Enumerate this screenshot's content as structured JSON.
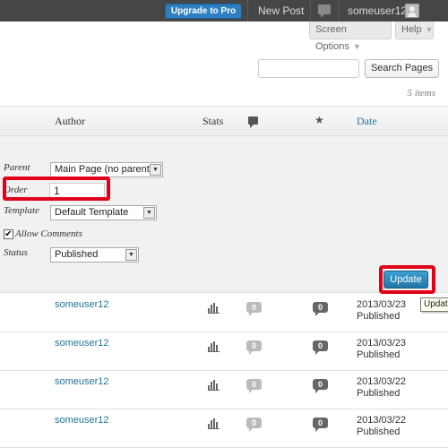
{
  "adminbar": {
    "upgrade_label": "Upgrade to Pro",
    "new_post_label": "New Post",
    "username": "someuser12"
  },
  "screen_meta": {
    "screen_options_label": "Screen Options",
    "help_label": "Help"
  },
  "search": {
    "value": "",
    "button_label": "Search Pages"
  },
  "items_count": "5 items",
  "table": {
    "columns": {
      "author": "Author",
      "stats": "Stats",
      "date": "Date"
    }
  },
  "quick_edit": {
    "parent_label": "Parent",
    "parent_value": "Main Page (no parent)",
    "order_label": "Order",
    "order_value": "1",
    "template_label": "Template",
    "template_value": "Default Template",
    "allow_comments_label": "Allow Comments",
    "allow_comments_checked": "✔",
    "status_label": "Status",
    "status_value": "Published",
    "update_label": "Update",
    "tooltip": "Update"
  },
  "rows": [
    {
      "author": "someuser12",
      "comments_pending": "0",
      "comments": "0",
      "date": "2013/03/23",
      "status": "Published"
    },
    {
      "author": "someuser12",
      "comments_pending": "0",
      "comments": "0",
      "date": "2013/03/23",
      "status": "Published"
    },
    {
      "author": "someuser12",
      "comments_pending": "0",
      "comments": "0",
      "date": "2013/03/22",
      "status": "Published"
    },
    {
      "author": "someuser12",
      "comments_pending": "0",
      "comments": "0",
      "date": "2013/03/22",
      "status": "Published"
    }
  ],
  "colors": {
    "adminbar_bg": "#464646",
    "link": "#21759b",
    "highlight": "#e10019",
    "primary_button": "#2177a8"
  }
}
